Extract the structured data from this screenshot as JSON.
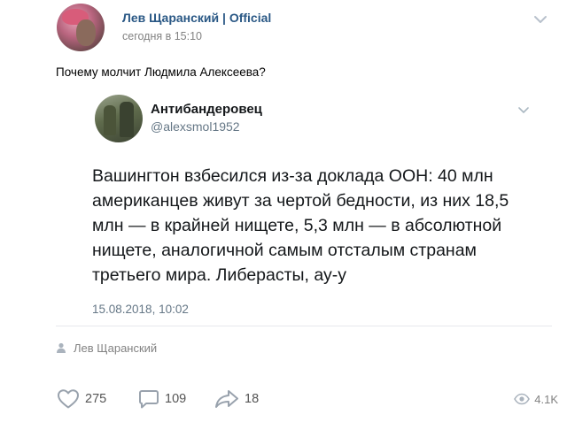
{
  "post": {
    "author": "Лев Щаранский | Official",
    "time": "сегодня в 15:10",
    "text": "Почему молчит Людмила Алексеева?",
    "signer": "Лев Щаранский"
  },
  "tweet": {
    "name": "Антибандеровец",
    "handle": "@alexsmol1952",
    "body": "Вашингтон взбесился из-за доклада ООН:  40 млн американцев живут за чертой бедности, из них 18,5 млн — в крайней нищете, 5,3 млн — в абсолютной нищете, аналогичной самым отсталым странам третьего мира. Либерасты, ау-у",
    "date": "15.08.2018, 10:02"
  },
  "actions": {
    "likes": "275",
    "comments": "109",
    "shares": "18",
    "views": "4.1K"
  },
  "icons": {
    "like": "heart-icon",
    "comment": "comment-icon",
    "share": "share-arrow-icon",
    "views": "eye-icon",
    "menu": "chevron-down-icon",
    "signer": "person-icon"
  },
  "colors": {
    "author_link": "#2a5885",
    "muted": "#828282",
    "icon": "#99a2ad"
  }
}
